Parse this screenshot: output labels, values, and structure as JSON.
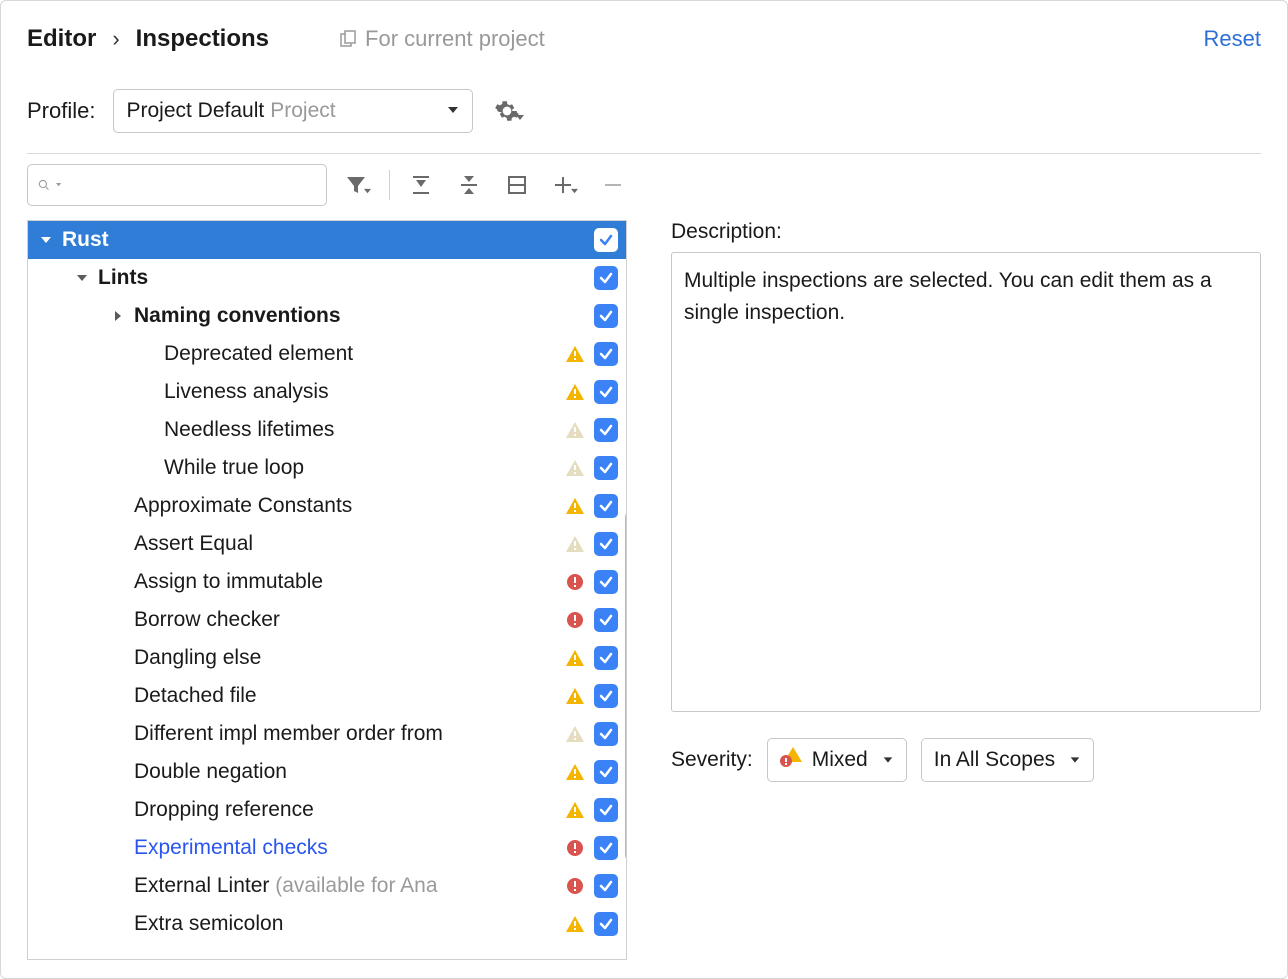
{
  "breadcrumb": {
    "root": "Editor",
    "current": "Inspections"
  },
  "forProjectLabel": "For current project",
  "resetLabel": "Reset",
  "profile": {
    "label": "Profile:",
    "name": "Project Default",
    "scope": "Project"
  },
  "search": {
    "placeholder": ""
  },
  "tree": {
    "rootLabel": "Rust",
    "lintsLabel": "Lints",
    "namingLabel": "Naming conventions",
    "items": [
      {
        "label": "Deprecated element",
        "severity": "warn",
        "indent": 3
      },
      {
        "label": "Liveness analysis",
        "severity": "warn",
        "indent": 3
      },
      {
        "label": "Needless lifetimes",
        "severity": "weak",
        "indent": 3
      },
      {
        "label": "While true loop",
        "severity": "weak",
        "indent": 3
      },
      {
        "label": "Approximate Constants",
        "severity": "warn",
        "indent": 2
      },
      {
        "label": "Assert Equal",
        "severity": "weak",
        "indent": 2
      },
      {
        "label": "Assign to immutable",
        "severity": "error",
        "indent": 2
      },
      {
        "label": "Borrow checker",
        "severity": "error",
        "indent": 2
      },
      {
        "label": "Dangling else",
        "severity": "warn",
        "indent": 2
      },
      {
        "label": "Detached file",
        "severity": "warn",
        "indent": 2
      },
      {
        "label": "Different impl member order from",
        "severity": "weak",
        "indent": 2,
        "clipped": true
      },
      {
        "label": "Double negation",
        "severity": "warn",
        "indent": 2
      },
      {
        "label": "Dropping reference",
        "severity": "warn",
        "indent": 2
      },
      {
        "label": "Experimental checks",
        "severity": "error",
        "indent": 2,
        "link": true
      },
      {
        "label": "External Linter",
        "suffix": " (available for Ana",
        "severity": "error",
        "indent": 2
      },
      {
        "label": "Extra semicolon",
        "severity": "warn",
        "indent": 2
      }
    ]
  },
  "description": {
    "label": "Description:",
    "text": "Multiple inspections are selected. You can edit them as a single inspection."
  },
  "severity": {
    "label": "Severity:",
    "value": "Mixed",
    "scope": "In All Scopes"
  }
}
